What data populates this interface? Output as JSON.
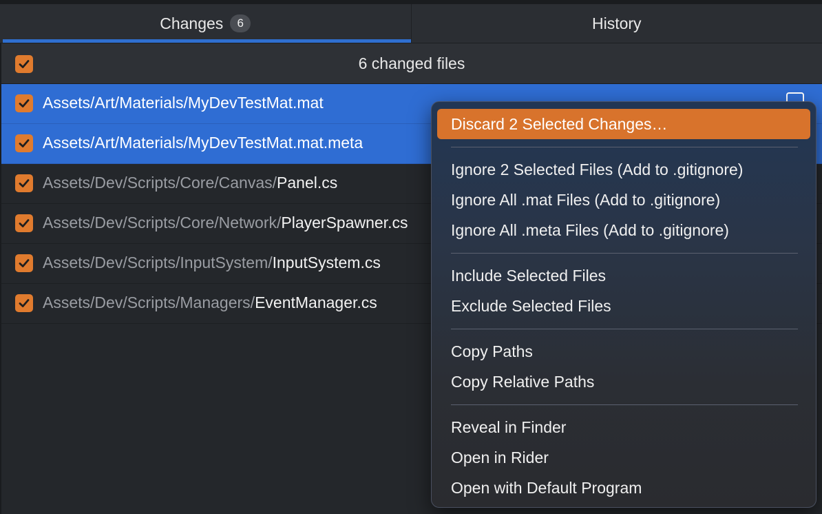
{
  "tabs": [
    {
      "label": "Changes",
      "badge": "6",
      "active": true
    },
    {
      "label": "History",
      "active": false
    }
  ],
  "header": {
    "label": "6 changed files",
    "checked": true
  },
  "files": [
    {
      "dir": "Assets/Art/Materials/",
      "name": "MyDevTestMat.mat",
      "selected": true,
      "checked": true
    },
    {
      "dir": "Assets/Art/Materials/",
      "name": "MyDevTestMat.mat.meta",
      "selected": true,
      "checked": true
    },
    {
      "dir": "Assets/Dev/Scripts/Core/Canvas/",
      "name": "Panel.cs",
      "selected": false,
      "checked": true
    },
    {
      "dir": "Assets/Dev/Scripts/Core/Network/",
      "name": "PlayerSpawner.cs",
      "selected": false,
      "checked": true
    },
    {
      "dir": "Assets/Dev/Scripts/InputSystem/",
      "name": "InputSystem.cs",
      "selected": false,
      "checked": true
    },
    {
      "dir": "Assets/Dev/Scripts/Managers/",
      "name": "EventManager.cs",
      "selected": false,
      "checked": true
    }
  ],
  "context_menu": {
    "groups": [
      [
        "Discard 2 Selected Changes…"
      ],
      [
        "Ignore 2 Selected Files (Add to .gitignore)",
        "Ignore All .mat Files (Add to .gitignore)",
        "Ignore All .meta Files (Add to .gitignore)"
      ],
      [
        "Include Selected Files",
        "Exclude Selected Files"
      ],
      [
        "Copy Paths",
        "Copy Relative Paths"
      ],
      [
        "Reveal in Finder",
        "Open in Rider",
        "Open with Default Program"
      ]
    ],
    "highlighted": "Discard 2 Selected Changes…"
  },
  "colors": {
    "accent_blue": "#2f6dd3",
    "checkbox_orange": "#e07b2e",
    "menu_highlight": "#d8732c"
  },
  "icons": {
    "checkbox": "checkmark-icon",
    "row_action": "square-icon"
  }
}
